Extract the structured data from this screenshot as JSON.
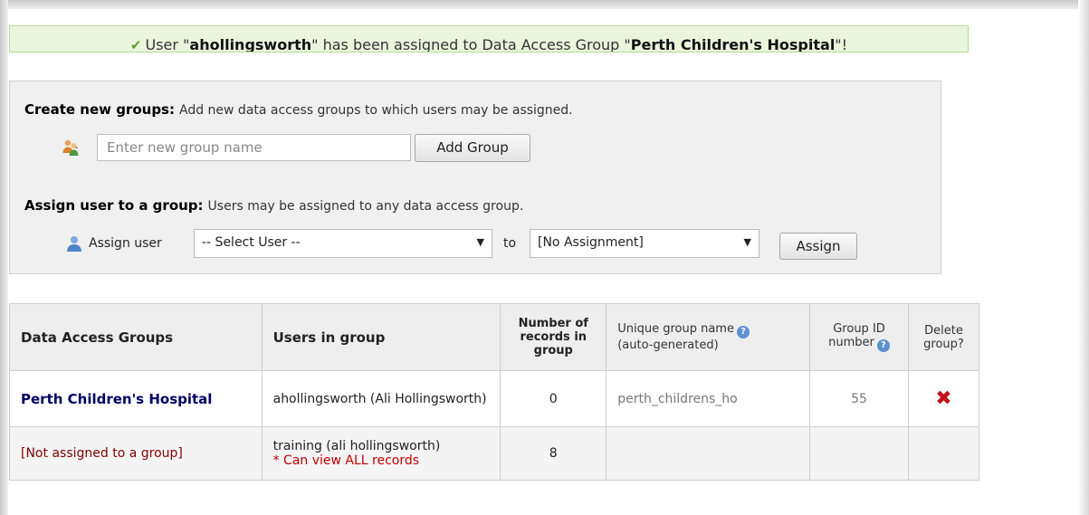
{
  "banner": {
    "prefix": "User \"",
    "user": "ahollingsworth",
    "middle": "\" has been assigned to Data Access Group \"",
    "group": "Perth Children's Hospital",
    "suffix": "\"!",
    "icon": "check-icon"
  },
  "create": {
    "title": "Create new groups:",
    "desc": "Add new data access groups to which users may be assigned.",
    "placeholder": "Enter new group name",
    "button": "Add Group",
    "icon": "group-icon"
  },
  "assign": {
    "title": "Assign user to a group:",
    "desc": "Users may be assigned to any data access group.",
    "label": "Assign user",
    "user_select": "-- Select User --",
    "to": "to",
    "group_select": "[No Assignment]",
    "button": "Assign",
    "icon": "user-icon"
  },
  "table": {
    "headers": {
      "groups": "Data Access Groups",
      "users": "Users in group",
      "records": "Number of records in group",
      "unique": "Unique group name",
      "unique_sub": "(auto-generated)",
      "groupid": "Group ID number",
      "delete": "Delete group?"
    },
    "rows": [
      {
        "group": "Perth Children's Hospital",
        "users": "ahollingsworth (Ali Hollingsworth)",
        "records": "0",
        "unique": "perth_childrens_ho",
        "id": "55"
      },
      {
        "group": "[Not assigned to a group]",
        "users": "training (ali hollingsworth)",
        "note": "* Can view ALL records",
        "records": "8"
      }
    ]
  },
  "colors": {
    "accent": "#000066",
    "success_bg": "#eaf5dc",
    "delete": "#c0141a"
  }
}
